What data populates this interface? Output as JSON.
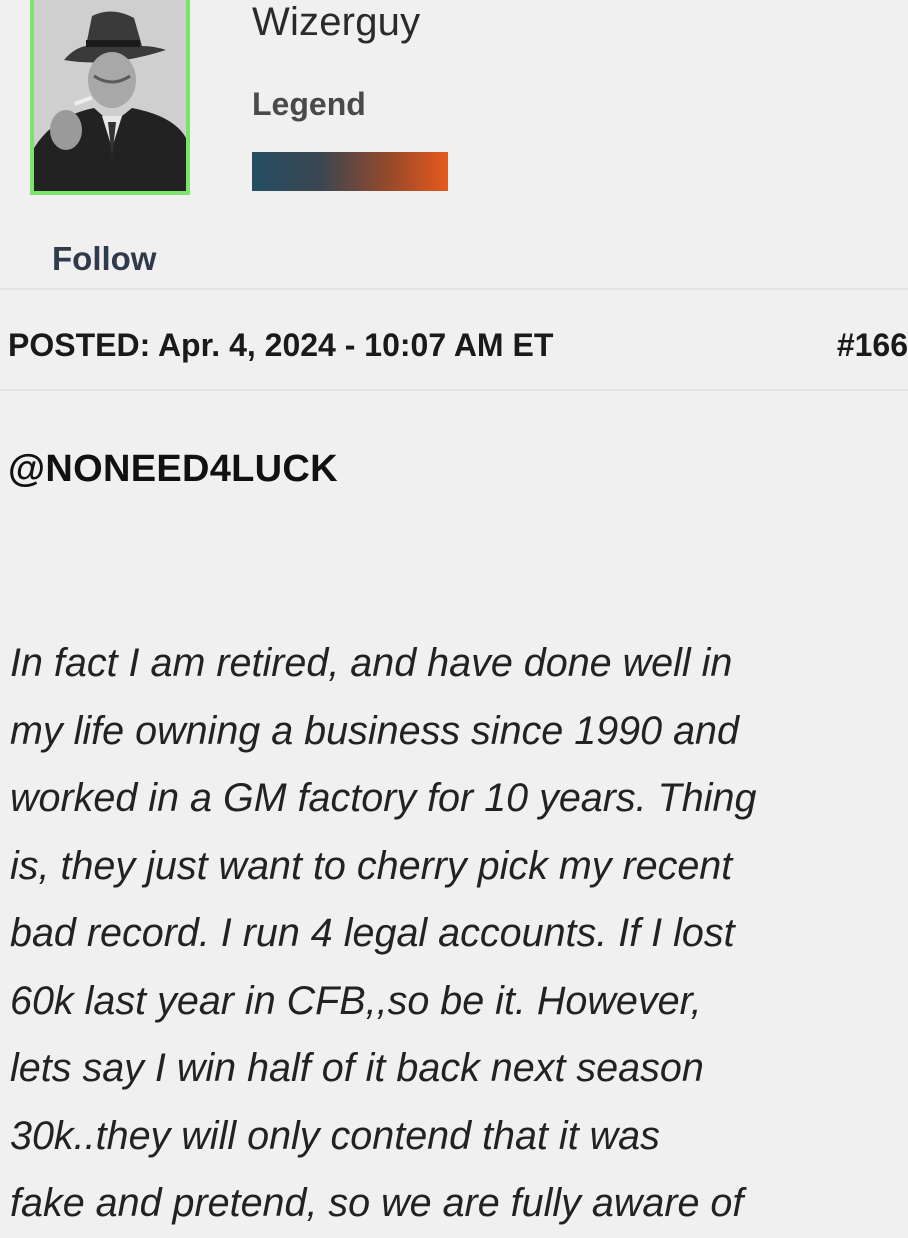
{
  "author": {
    "username": "Wizerguy",
    "rank": "Legend",
    "follow_label": "Follow",
    "rank_bar_colors": [
      "#244e63",
      "#e65a1c"
    ],
    "avatar_border_color": "#7be46a"
  },
  "post": {
    "posted": "POSTED: Apr. 4, 2024 - 10:07 AM ET",
    "number": "#166",
    "mention": "@NONEED4LUCK",
    "body_lines": [
      "In fact I am retired, and have done well in",
      "my life owning a business since 1990 and",
      "worked in a GM factory for 10 years. Thing",
      "is, they just want to cherry pick my recent",
      "bad record. I run 4 legal accounts. If I lost",
      "60k last year in CFB,,so be it. However,",
      "lets say I win half of it back next season",
      "30k..they will only contend that it was",
      "fake and pretend, so we are fully aware of"
    ]
  }
}
